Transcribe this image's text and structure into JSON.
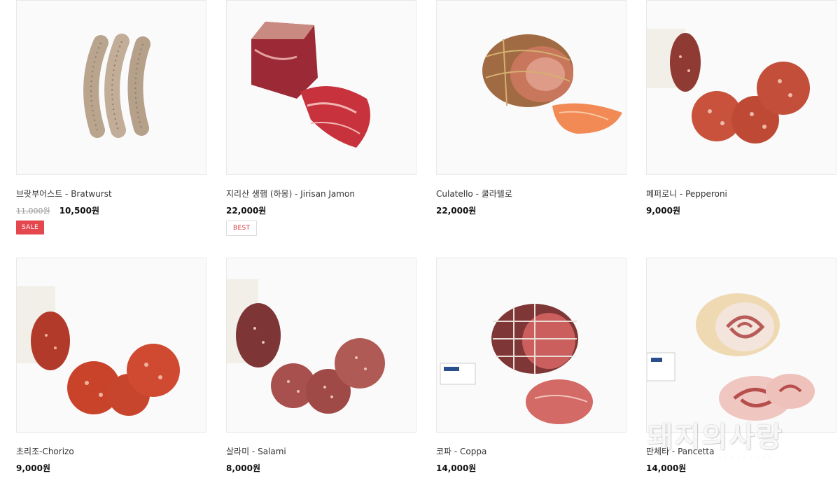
{
  "products": [
    {
      "name": "브랏부어스트 - Bratwurst",
      "old_price": "11,000원",
      "price": "10,500원",
      "badge": "SALE",
      "image_icon": "bratwurst-sausage-image"
    },
    {
      "name": "지리산 생햄 (하몽) - Jirisan Jamon",
      "old_price": "",
      "price": "22,000원",
      "badge": "BEST",
      "image_icon": "jamon-ham-image"
    },
    {
      "name": "Culatello - 쿨라텔로",
      "old_price": "",
      "price": "22,000원",
      "badge": "",
      "image_icon": "culatello-ham-image"
    },
    {
      "name": "페퍼로니 - Pepperoni",
      "old_price": "",
      "price": "9,000원",
      "badge": "",
      "image_icon": "pepperoni-image"
    },
    {
      "name": "초리조-Chorizo",
      "old_price": "",
      "price": "9,000원",
      "badge": "",
      "image_icon": "chorizo-image"
    },
    {
      "name": "살라미 - Salami",
      "old_price": "",
      "price": "8,000원",
      "badge": "",
      "image_icon": "salami-image"
    },
    {
      "name": "코파 - Coppa",
      "old_price": "",
      "price": "14,000원",
      "badge": "",
      "image_icon": "coppa-image"
    },
    {
      "name": "판체타 - Pancetta",
      "old_price": "",
      "price": "14,000원",
      "badge": "",
      "image_icon": "pancetta-image"
    }
  ],
  "watermark": {
    "text": "돼지의사랑"
  },
  "colors": {
    "sale_badge": "#e5474f",
    "best_badge_text": "#d6383f"
  }
}
